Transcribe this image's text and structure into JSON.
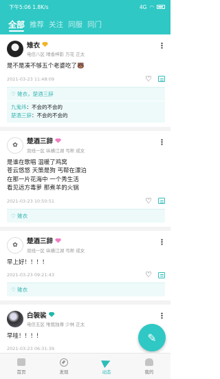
{
  "status_bar": {
    "time": "下午5:06",
    "speed": "1.8K/s",
    "signal": "4G",
    "battery": "battery-icon"
  },
  "tabs": [
    {
      "label": "全部"
    },
    {
      "label": "推荐"
    },
    {
      "label": "关注"
    },
    {
      "label": "同服"
    },
    {
      "label": "同门"
    }
  ],
  "posts": [
    {
      "name": "雉衣",
      "badge_color": "#f1b52a",
      "meta": "电信八区 晴香梓影 万花 正太",
      "content": [
        "是不是凑不够五个老婆吃了🐻"
      ],
      "time": "2021-03-23 11:48:09",
      "likes": "♡ 雉衣，楚酒三辞",
      "comments": [
        {
          "user": "九鬼纬",
          "text": "：不会的不会的"
        },
        {
          "user": "楚酒三辞",
          "text": "：不会的不会的"
        }
      ]
    },
    {
      "name": "楚酒三辞",
      "badge_color": "#f07ec1",
      "meta": "双线一区 纵横江湖 丐帮 成女",
      "content": [
        "是谁在歌唱 温暖了鸡窝",
        "苍云悠悠 天策是狗 丐帮在漂泊",
        "在那一片花海中 一个秀生活",
        "看见远方毒萝 那煮羊的火锅"
      ],
      "time": "2021-03-23 10:50:51",
      "likes": "♡ 雉衣"
    },
    {
      "name": "楚酒三辞",
      "badge_color": "#f07ec1",
      "meta": "双线一区 纵横江湖 丐帮 成女",
      "content": [
        "早上好！！！！"
      ],
      "time": "2021-03-23 09:21:43",
      "likes": "♡ 雉衣"
    },
    {
      "name": "白袈裟",
      "badge_color": "#22b8a8",
      "meta": "电信五区 唯我独尊 少林 正太",
      "content": [
        "早哇！！！！"
      ],
      "time": "2021-03-23 06:31:39"
    }
  ],
  "fab": {
    "icon": "pencil-icon"
  },
  "bottom_nav": [
    {
      "label": "首页",
      "icon": "home-icon"
    },
    {
      "label": "发现",
      "icon": "compass-icon"
    },
    {
      "label": "动态",
      "icon": "send-icon",
      "active": true
    },
    {
      "label": "我的",
      "icon": "profile-icon"
    }
  ]
}
